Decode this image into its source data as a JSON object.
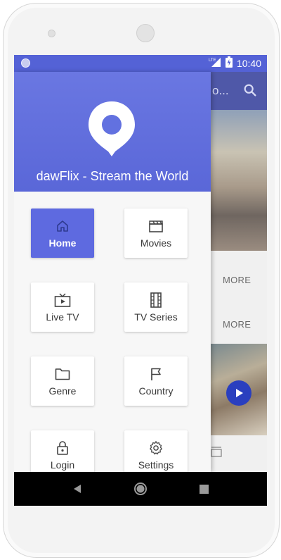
{
  "status_bar": {
    "time": "10:40",
    "network": "LTE"
  },
  "background_app": {
    "title": "o...",
    "more_1": "MORE",
    "more_2": "MORE"
  },
  "drawer": {
    "title": "dawFlix - Stream the World",
    "items": [
      {
        "label": "Home",
        "icon": "home-icon",
        "active": true
      },
      {
        "label": "Movies",
        "icon": "movie-clapper-icon",
        "active": false
      },
      {
        "label": "Live TV",
        "icon": "tv-icon",
        "active": false
      },
      {
        "label": "TV Series",
        "icon": "film-strip-icon",
        "active": false
      },
      {
        "label": "Genre",
        "icon": "folder-icon",
        "active": false
      },
      {
        "label": "Country",
        "icon": "flag-icon",
        "active": false
      },
      {
        "label": "Login",
        "icon": "lock-icon",
        "active": false
      },
      {
        "label": "Settings",
        "icon": "gear-icon",
        "active": false
      }
    ]
  },
  "colors": {
    "primary": "#5e6ae0",
    "status_bar": "#5462d6",
    "header": "#6a77e2"
  }
}
